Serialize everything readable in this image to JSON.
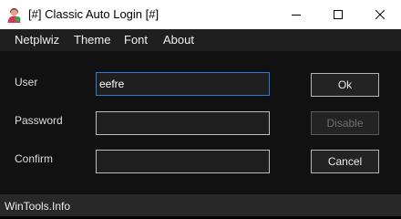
{
  "window": {
    "title": "[#] Classic Auto Login [#]",
    "icon": "user-avatar-icon"
  },
  "titlebar_controls": {
    "minimize_icon": "minimize-icon",
    "maximize_icon": "maximize-icon",
    "close_icon": "close-icon"
  },
  "menu": {
    "items": [
      {
        "label": "Netplwiz"
      },
      {
        "label": "Theme"
      },
      {
        "label": "Font"
      },
      {
        "label": "About"
      }
    ]
  },
  "form": {
    "user": {
      "label": "User",
      "value": "eefre",
      "focused": true
    },
    "password": {
      "label": "Password",
      "value": ""
    },
    "confirm": {
      "label": "Confirm",
      "value": ""
    }
  },
  "buttons": {
    "ok": {
      "label": "Ok"
    },
    "disable": {
      "label": "Disable",
      "enabled": false
    },
    "cancel": {
      "label": "Cancel"
    }
  },
  "statusbar": {
    "text": "WinTools.Info"
  },
  "colors": {
    "titlebar_bg": "#ffffff",
    "window_bg": "#1f1f1f",
    "content_bg": "#111111",
    "statusbar_bg": "#282828",
    "focus_border": "#2b7bd6",
    "text": "#e8e8e8"
  }
}
